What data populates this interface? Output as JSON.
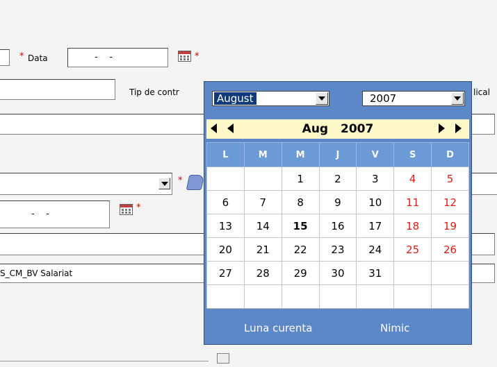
{
  "form": {
    "required_mark": "*",
    "date_label": "Data",
    "date_value": "-    -",
    "date2_value": "-    -",
    "contract_label_partial": "Tip de contr",
    "right_label_partial": "lical",
    "salariat_value": "S_CM_BV Salariat"
  },
  "calendar": {
    "month_select": "August",
    "year_select": "2007",
    "nav_title": "Aug 2007",
    "weekdays": [
      "L",
      "M",
      "M",
      "J",
      "V",
      "S",
      "D"
    ],
    "weeks": [
      [
        "",
        "",
        "1",
        "2",
        "3",
        "4",
        "5"
      ],
      [
        "6",
        "7",
        "8",
        "9",
        "10",
        "11",
        "12"
      ],
      [
        "13",
        "14",
        "15",
        "16",
        "17",
        "18",
        "19"
      ],
      [
        "20",
        "21",
        "22",
        "23",
        "24",
        "25",
        "26"
      ],
      [
        "27",
        "28",
        "29",
        "30",
        "31",
        "",
        ""
      ],
      [
        "",
        "",
        "",
        "",
        "",
        "",
        ""
      ]
    ],
    "today": "15",
    "footer_current": "Luna curenta",
    "footer_none": "Nimic"
  }
}
